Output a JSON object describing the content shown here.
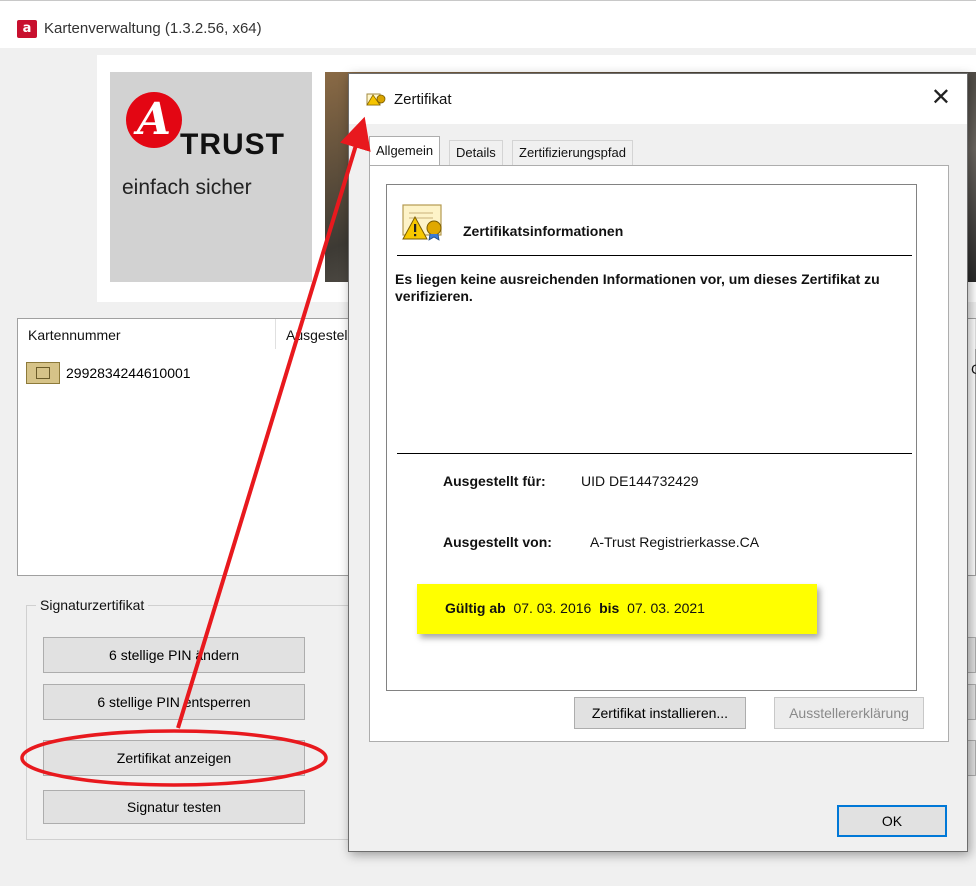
{
  "main_window": {
    "title": "Kartenverwaltung (1.3.2.56, x64)",
    "app_icon_letter": "a",
    "logo": {
      "mark_letter": "A",
      "word": "TRUST",
      "tagline": "einfach sicher"
    },
    "card_list": {
      "columns": [
        "Kartennummer",
        "Ausgestellt"
      ],
      "rows": [
        {
          "number": "2992834244610001",
          "trailing_text": "CO"
        }
      ]
    },
    "signature_group": {
      "label": "Signaturzertifikat",
      "buttons": [
        "6 stellige PIN ändern",
        "6 stellige PIN entsperren",
        "Zertifikat anzeigen",
        "Signatur testen"
      ]
    }
  },
  "dialog": {
    "title": "Zertifikat",
    "close_glyph": "✕",
    "tabs": [
      "Allgemein",
      "Details",
      "Zertifizierungspfad"
    ],
    "active_tab": "Allgemein",
    "info_title": "Zertifikatsinformationen",
    "warning_text": "Es liegen keine ausreichenden Informationen vor, um dieses Zertifikat zu verifizieren.",
    "issued_to_label": "Ausgestellt für:",
    "issued_to_value": "UID DE144732429",
    "issued_by_label": "Ausgestellt von:",
    "issued_by_value": "A-Trust Registrierkasse.CA",
    "valid_from_label": "Gültig ab",
    "valid_from": "07. 03. 2016",
    "valid_to_label": "bis",
    "valid_to": "07. 03. 2021",
    "install_button": "Zertifikat installieren...",
    "issuer_statement_button": "Ausstellererklärung",
    "ok_button": "OK"
  },
  "annotation": {
    "color": "#e8191e",
    "highlight_color": "#ffff00"
  },
  "icons": [
    "app-logo-icon",
    "certificate-icon",
    "certificate-warning-icon",
    "smart-card-chip-icon",
    "close-icon"
  ]
}
